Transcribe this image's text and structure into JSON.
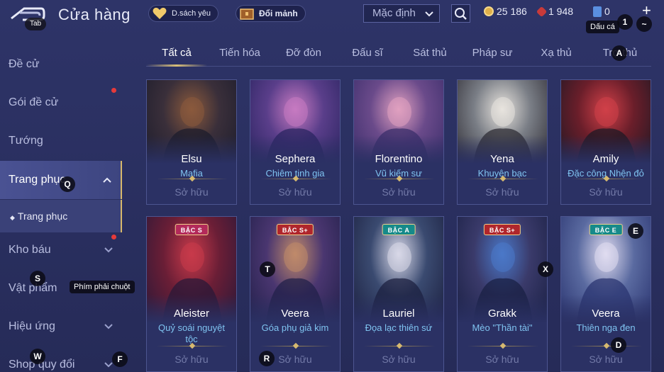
{
  "header": {
    "tab_hint": "Tab",
    "title": "Cửa hàng",
    "wishlist_label": "D.sách yêu",
    "exchange_label": "Đổi mảnh",
    "sort_value": "Mặc định",
    "gold": "25 186",
    "gems": "1 948",
    "coupons": "0",
    "coupon_tooltip": "Dấu cá",
    "hint_1": "1",
    "hint_tilde": "~",
    "plus_label": "+"
  },
  "sidebar": {
    "items": [
      {
        "label": "Đề cử"
      },
      {
        "label": "Gói đề cử"
      },
      {
        "label": "Tướng"
      },
      {
        "label": "Trang phục"
      },
      {
        "label": "Kho báu"
      },
      {
        "label": "Vật phẩm"
      },
      {
        "label": "Hiệu ứng"
      },
      {
        "label": "Shop quy đổi"
      }
    ],
    "sub_item": "Trang phục"
  },
  "tabs": [
    "Tất cả",
    "Tiến hóa",
    "Đỡ đòn",
    "Đấu sĩ",
    "Sát thủ",
    "Pháp sư",
    "Xạ thủ",
    "Trợ thủ"
  ],
  "cards": [
    {
      "hero": "Elsu",
      "skin": "Mafia",
      "status": "Sở hữu",
      "rank": "",
      "palette": [
        "#3a2f3a",
        "#8b5a3c",
        "#1c1c2c"
      ]
    },
    {
      "hero": "Sephera",
      "skin": "Chiêm tinh gia",
      "status": "Sở hữu",
      "rank": "",
      "palette": [
        "#5a3e8a",
        "#c77ac1",
        "#2a2460"
      ]
    },
    {
      "hero": "Florentino",
      "skin": "Vũ kiếm sư",
      "status": "Sở hữu",
      "rank": "",
      "palette": [
        "#6a4a8a",
        "#e0a0c0",
        "#3a2d6a"
      ]
    },
    {
      "hero": "Yena",
      "skin": "Khuyên bạc",
      "status": "Sở hữu",
      "rank": "",
      "palette": [
        "#7a7e86",
        "#e8e4de",
        "#2e2c34"
      ]
    },
    {
      "hero": "Amily",
      "skin": "Đặc công Nhện đỏ",
      "status": "Sở hữu",
      "rank": "",
      "palette": [
        "#6a1e2a",
        "#d04048",
        "#1e1824"
      ]
    },
    {
      "hero": "Aleister",
      "skin": "Quỷ soái nguyệt tộc",
      "status": "Sở hữu",
      "rank": "BẬC S",
      "palette": [
        "#6a1e36",
        "#c83a4a",
        "#2a1838"
      ]
    },
    {
      "hero": "Veera",
      "skin": "Góa phụ giả kim",
      "status": "Sở hữu",
      "rank": "BẬC S+",
      "palette": [
        "#4a3670",
        "#c08a6a",
        "#22204a"
      ]
    },
    {
      "hero": "Lauriel",
      "skin": "Đọa lạc thiên sứ",
      "status": "Sở hữu",
      "rank": "BẬC A",
      "palette": [
        "#3a4a70",
        "#d8d8e8",
        "#1c2040"
      ]
    },
    {
      "hero": "Grakk",
      "skin": "Mèo \"Thần tài\"",
      "status": "Sở hữu",
      "rank": "BẬC S+",
      "palette": [
        "#3a3a6a",
        "#4a78c8",
        "#1a2044"
      ]
    },
    {
      "hero": "Veera",
      "skin": "Thiên nga đen",
      "status": "Sở hữu",
      "rank": "BẬC E",
      "palette": [
        "#5a6aa0",
        "#e0dcf0",
        "#2a3470"
      ]
    }
  ],
  "key_hints": {
    "q": "Q",
    "a": "A",
    "s": "S",
    "t": "T",
    "x": "X",
    "e": "E",
    "w": "W",
    "f": "F",
    "r": "R",
    "d": "D"
  },
  "right_click_tooltip": "Phím phải chuột",
  "colors": {
    "accent_gold": "#d7b86a",
    "skin_name": "#7fc3f0",
    "notification": "#e63a3a"
  }
}
